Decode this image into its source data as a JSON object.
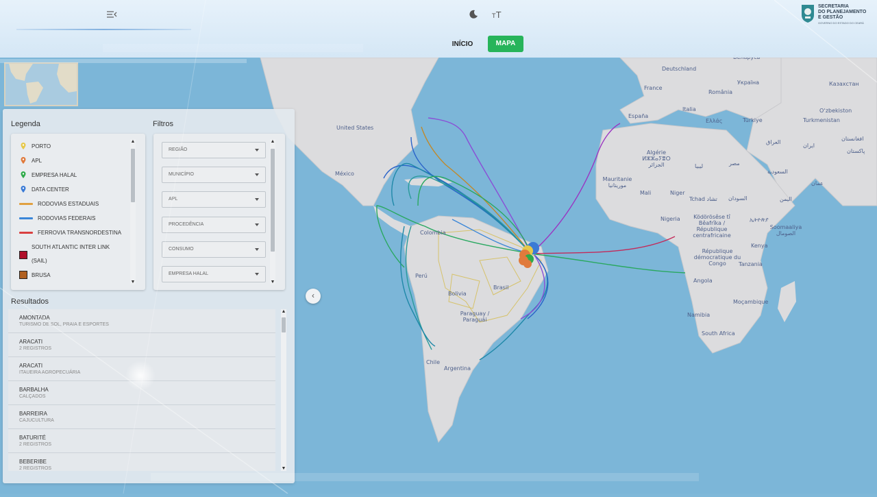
{
  "header": {
    "tabs": [
      {
        "label": "INÍCIO",
        "active": false
      },
      {
        "label": "MAPA",
        "active": true
      }
    ],
    "icons": [
      "menu-collapse-icon",
      "moon-icon",
      "font-size-icon"
    ],
    "logo": {
      "line1": "SECRETARIA",
      "line2": "DO PLANEJAMENTO",
      "line3": "E GESTÃO",
      "line4": "GOVERNO DO ESTADO DO CEARÁ"
    },
    "accent_color": "#27b45a"
  },
  "legend": {
    "title": "Legenda",
    "items": [
      {
        "label": "PORTO",
        "kind": "pin",
        "color": "#e6c84a"
      },
      {
        "label": "APL",
        "kind": "pin",
        "color": "#e07a3c"
      },
      {
        "label": "EMPRESA HALAL",
        "kind": "pin",
        "color": "#2faa4a"
      },
      {
        "label": "DATA CENTER",
        "kind": "pin",
        "color": "#3b7bd6"
      },
      {
        "label": "RODOVIAS ESTADUAIS",
        "kind": "line",
        "color": "#e0a040"
      },
      {
        "label": "RODOVIAS FEDERAIS",
        "kind": "line",
        "color": "#3a86d8"
      },
      {
        "label": "FERROVIA TRANSNORDESTINA",
        "kind": "line",
        "color": "#d94040"
      },
      {
        "label": "SOUTH ATLANTIC INTER LINK",
        "label2": "(SAIL)",
        "kind": "swatch",
        "color": "#b0102a"
      },
      {
        "label": "BRUSA",
        "kind": "swatch",
        "color": "#b06020"
      }
    ]
  },
  "filters": {
    "title": "Filtros",
    "items": [
      "REGIÃO",
      "MUNICÍPIO",
      "APL",
      "PROCEDÊNCIA",
      "CONSUMO",
      "EMPRESA HALAL"
    ]
  },
  "results": {
    "title": "Resultados",
    "rows": [
      {
        "title": "AMONTADA",
        "subtitle": "TURISMO DE SOL, PRAIA E ESPORTES"
      },
      {
        "title": "ARACATI",
        "subtitle": "2 REGISTROS"
      },
      {
        "title": "ARACATI",
        "subtitle": "ITAUEIRA AGROPECUÁRIA"
      },
      {
        "title": "BARBALHA",
        "subtitle": "CALÇADOS"
      },
      {
        "title": "BARREIRA",
        "subtitle": "CAJUCULTURA"
      },
      {
        "title": "BATURITÉ",
        "subtitle": "2 REGISTROS"
      },
      {
        "title": "BEBERIBE",
        "subtitle": "2 REGISTROS"
      }
    ]
  },
  "map": {
    "labels": [
      "Deutschland",
      "France",
      "España",
      "Italia",
      "România",
      "Україна",
      "Беларусь",
      "Казахстан",
      "Oʻzbekiston",
      "Turkmenistan",
      "Türkiye",
      "Ελλάς",
      "العراق",
      "ایران",
      "افغانستان",
      "پاکستان",
      "السعودية",
      "عمان",
      "اليمن",
      "مصر",
      "ليبيا",
      "Algérie ⵍⵣⵣⴰⵢⴻⵔ الجزائر",
      "Mauritanie موريتانيا",
      "Mali",
      "Niger",
      "Tchad تشاد",
      "السودان",
      "Nigeria",
      "ኢትዮጵያ",
      "Soomaaliya الصومال",
      "Kenya",
      "Ködörösêse tî Bêafrîka / République centrafricaine",
      "République démocratique du Congo",
      "Tanzania",
      "Angola",
      "Moçambique",
      "Namibia",
      "South Africa",
      "United States",
      "México",
      "Colombia",
      "Perú",
      "Brasil",
      "Bolivia",
      "Paraguay / Paraguái",
      "Chile",
      "Argentina"
    ]
  }
}
